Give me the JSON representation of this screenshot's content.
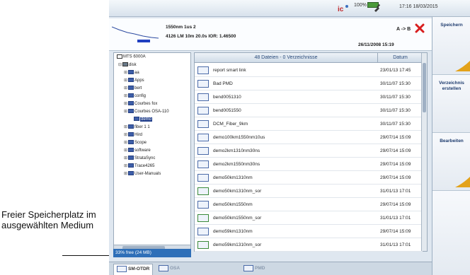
{
  "status": {
    "battery_label": "100%",
    "time": "17:16 18/03/2015"
  },
  "trace": {
    "line1": "1550nm 1us  2",
    "line2": "4126 LM  10m  20.0s  IOR: 1.46500",
    "ab_label": "A -> B",
    "date": "26/11/2008  15:19"
  },
  "panel": {
    "save_label": "Speichern",
    "mkdir_label": "Verzeichnis erstellen",
    "edit_label": "Bearbeiten"
  },
  "tree": {
    "root": "MTS 6000A",
    "disk": "disk",
    "items": [
      "aa",
      "Apps",
      "bert",
      "config",
      "Courbes fox",
      "Courbes OSA-110",
      "demo",
      "fiber 1 1",
      "Hird",
      "Scope",
      "software",
      "StrataSync",
      "Trace4265",
      "User-Manuals"
    ],
    "selected_index": 6
  },
  "list": {
    "header_name": "48 Dateien - 0 Verzeichnisse",
    "header_date": "Datum",
    "files": [
      {
        "name": "report smart link",
        "date": "23/01/13 17:45"
      },
      {
        "name": "Bad PMD",
        "date": "30/11/07 15:30"
      },
      {
        "name": "bend0051310",
        "date": "30/11/07 15:30"
      },
      {
        "name": "bend0051550",
        "date": "30/11/07 15:30"
      },
      {
        "name": "DCM_Fiber_9km",
        "date": "30/11/07 15:30"
      },
      {
        "name": "demo100km1550nm10us",
        "date": "29/07/14 15:09"
      },
      {
        "name": "demo2km1310nm30ns",
        "date": "29/07/14 15:09"
      },
      {
        "name": "demo2km1550nm30ns",
        "date": "29/07/14 15:09"
      },
      {
        "name": "demo50km1310nm",
        "date": "29/07/14 15:09"
      },
      {
        "name": "demo50km1310nm_sor",
        "date": "31/01/13 17:01"
      },
      {
        "name": "demo50km1550nm",
        "date": "29/07/14 15:09"
      },
      {
        "name": "demo50km1550nm_sor",
        "date": "31/01/13 17:01"
      },
      {
        "name": "demo59km1310nm",
        "date": "29/07/14 15:09"
      },
      {
        "name": "demo59km1310nm_sor",
        "date": "31/01/13 17:01"
      }
    ]
  },
  "free_space": "33% free (24 MB)",
  "tabs": {
    "otdr": "SM-OTDR",
    "osa": "OSA",
    "pmd": "PMD"
  },
  "callout": "Freier Speicherplatz im ausgewählten Medium",
  "colors": {
    "accent": "#1f3d8a",
    "free_bar": "#2e6fb8",
    "close": "#d81e1e"
  }
}
